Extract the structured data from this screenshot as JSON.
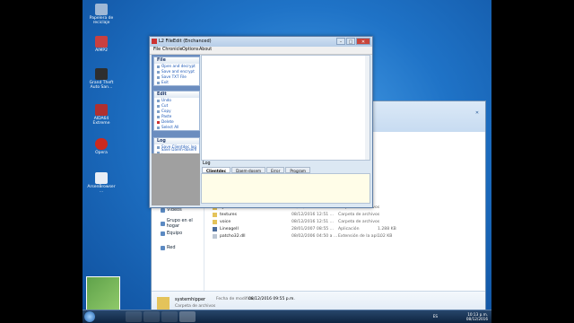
{
  "desktop_icons": [
    {
      "label": "Papelera de reciclaje",
      "color": "#9fb8d6"
    },
    {
      "label": "AIMP2",
      "color": "#c94040"
    },
    {
      "label": "Grand Theft Auto San...",
      "color": "#2e2e2e"
    },
    {
      "label": "AIDA64 Extreme",
      "color": "#b03030"
    },
    {
      "label": "Opera",
      "color": "#cc2a1e"
    },
    {
      "label": "ArsenBrowser ...",
      "color": "#e9eef6"
    }
  ],
  "explorer": {
    "nav": [
      "Vídeos",
      "Grupo en el hogar",
      "Equipo",
      "Red"
    ],
    "files": [
      {
        "name": "systemfiles",
        "date": "08/12/2016 12:51 ...",
        "type": "Carpeta de archivos",
        "size": ""
      },
      {
        "name": "textures",
        "date": "08/12/2016 12:51 ...",
        "type": "Carpeta de archivos",
        "size": ""
      },
      {
        "name": "voice",
        "date": "08/12/2016 12:51 ...",
        "type": "Carpeta de archivos",
        "size": ""
      },
      {
        "name": "LineageII",
        "date": "28/01/2007 08:55 ...",
        "type": "Aplicación",
        "size": "1.288 KB"
      },
      {
        "name": "patcho32.dll",
        "date": "08/02/2006 04:50 a ...",
        "type": "Extensión de la apl...",
        "size": "102 KB"
      }
    ],
    "details": {
      "name": "systemhipper",
      "type": "Carpeta de archivos",
      "date_label": "Fecha de modifica...",
      "date_value": "08/12/2016 09:55 p.m."
    }
  },
  "filebut": {
    "title": "L2 FileEdit (Enchanced)",
    "menu": [
      "File",
      "Chronicle",
      "Options",
      "About"
    ],
    "panels": [
      {
        "header": "File",
        "items": [
          "Open and decrypt",
          "Save and encrypt",
          "Save TXT File",
          "Exit"
        ]
      },
      {
        "header": "Edit",
        "items": [
          "Undo",
          "Cut",
          "Copy",
          "Paste",
          "Delete",
          "Select All"
        ]
      },
      {
        "header": "Log",
        "items": [
          "Save Clientdec log",
          "Save Daem-dosem log",
          "Save All"
        ]
      }
    ],
    "log_label": "Log",
    "tabs": [
      "Clientdec",
      "Daem-dosem",
      "Error",
      "Program"
    ]
  },
  "taskbar": {
    "lang": "ES",
    "time": "10:13 p.m.",
    "date": "08/12/2016"
  }
}
